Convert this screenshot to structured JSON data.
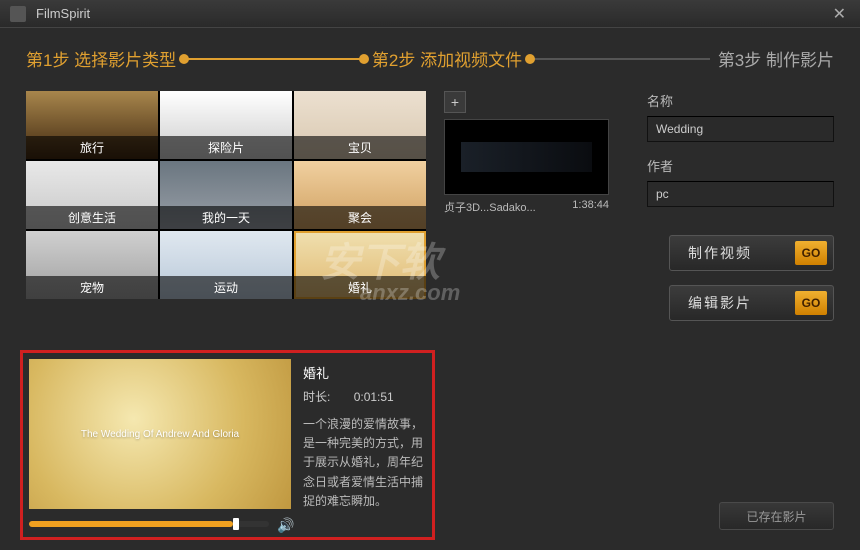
{
  "app": {
    "title": "FilmSpirit"
  },
  "steps": {
    "s1": "第1步 选择影片类型",
    "s2": "第2步 添加视频文件",
    "s3": "第3步 制作影片"
  },
  "tiles": [
    {
      "label": "旅行"
    },
    {
      "label": "探险片"
    },
    {
      "label": "宝贝"
    },
    {
      "label": "创意生活"
    },
    {
      "label": "我的一天"
    },
    {
      "label": "聚会"
    },
    {
      "label": "宠物"
    },
    {
      "label": "运动"
    },
    {
      "label": "婚礼"
    }
  ],
  "video": {
    "name": "贞子3D...Sadako...",
    "duration": "1:38:44"
  },
  "form": {
    "name_label": "名称",
    "name_value": "Wedding",
    "author_label": "作者",
    "author_value": "pc"
  },
  "actions": {
    "make": "制作视频",
    "edit": "编辑影片",
    "go": "GO",
    "saved": "已存在影片"
  },
  "preview": {
    "img_text": "The Wedding Of Andrew And Gloria",
    "title": "婚礼",
    "dur_label": "时长:",
    "dur_value": "0:01:51",
    "desc": "一个浪漫的爱情故事，是一种完美的方式，用于展示从婚礼，周年纪念日或者爱情生活中捕捉的难忘瞬加。"
  },
  "watermark": {
    "line1": "安下软",
    "line2": "anxz.com"
  }
}
